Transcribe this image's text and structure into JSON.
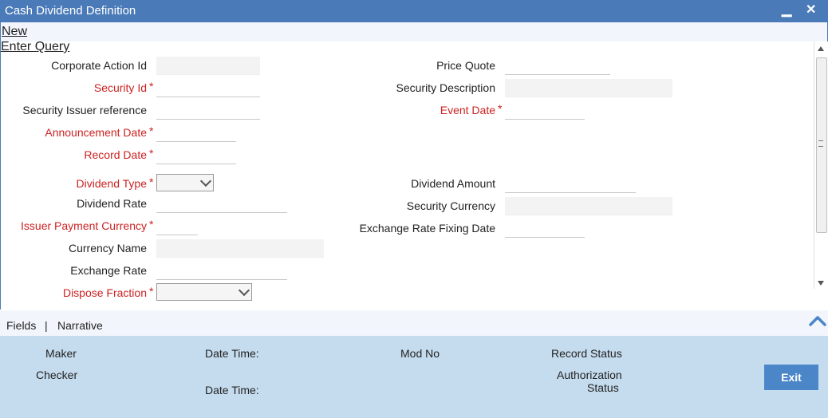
{
  "window": {
    "title": "Cash Dividend Definition",
    "minimize_glyph": "▁",
    "close_glyph": "✕"
  },
  "menu": {
    "new": "New",
    "enter_query": "Enter Query"
  },
  "form": {
    "left": {
      "corporate_action_id": "Corporate Action Id",
      "security_id": "Security Id",
      "security_issuer_reference": "Security Issuer reference",
      "announcement_date": "Announcement Date",
      "record_date": "Record Date",
      "dividend_type": "Dividend Type",
      "dividend_rate": "Dividend Rate",
      "issuer_payment_currency": "Issuer Payment Currency",
      "currency_name": "Currency Name",
      "exchange_rate": "Exchange Rate",
      "disposal_fraction": "Dispose Fraction"
    },
    "right": {
      "price_quote": "Price Quote",
      "security_description": "Security Description",
      "event_date": "Event Date",
      "dividend_amount": "Dividend Amount",
      "security_currency": "Security Currency",
      "exchange_rate_fixing_date": "Exchange Rate Fixing Date"
    },
    "required_mark": "*"
  },
  "tabs": {
    "fields": "Fields",
    "separator": "|",
    "narrative": "Narrative"
  },
  "footer": {
    "maker": "Maker",
    "checker": "Checker",
    "date_time_1": "Date Time:",
    "date_time_2": "Date Time:",
    "mod_no": "Mod No",
    "record_status": "Record Status",
    "authorization_status_line1": "Authorization",
    "authorization_status_line2": "Status",
    "exit": "Exit"
  },
  "colors": {
    "titlebar": "#4a7ab8",
    "required": "#cc2222",
    "footer": "#c5dcef",
    "exit_button": "#4a86c8"
  }
}
